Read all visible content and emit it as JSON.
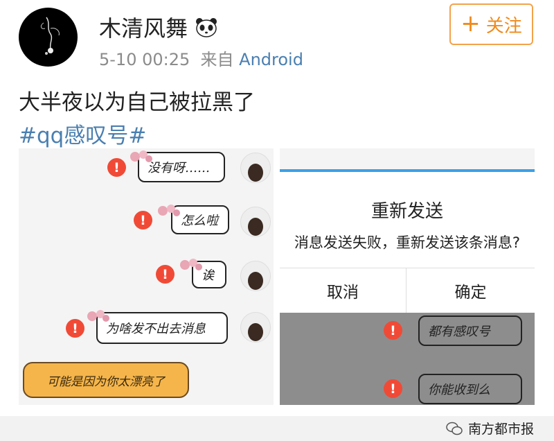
{
  "post": {
    "username": "木清风舞",
    "time": "5-10 00:25",
    "source_prefix": "来自",
    "source": "Android",
    "follow_label": "关注",
    "text": "大半夜以为自己被拉黑了",
    "hashtag": "#qq感叹号#"
  },
  "left_image": {
    "messages": [
      "没有呀……",
      "怎么啦",
      "诶",
      "为啥发不出去消息"
    ],
    "error_mark": "!",
    "banner": "可能是因为你太漂亮了"
  },
  "right_image": {
    "dialog_title": "重新发送",
    "dialog_message": "消息发送失败，重新发送该条消息?",
    "cancel": "取消",
    "confirm": "确定",
    "messages": [
      "都有感叹号",
      "你能收到么"
    ]
  },
  "footer": {
    "brand": "南方都市报"
  },
  "colors": {
    "link": "#4a7fb0",
    "follow": "#f08a1c",
    "error": "#f04a36"
  }
}
